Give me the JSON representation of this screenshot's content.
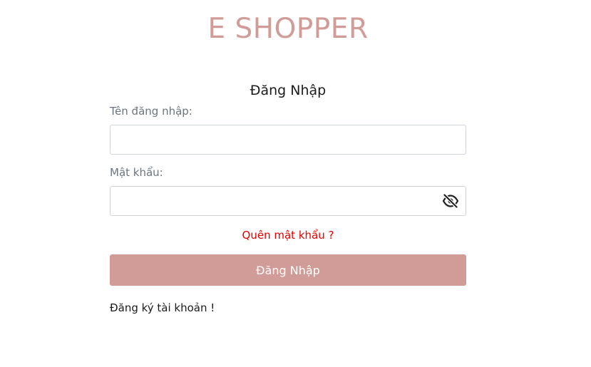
{
  "brand": {
    "title": "E SHOPPER"
  },
  "login": {
    "heading": "Đăng Nhập",
    "username_label": "Tên đăng nhập:",
    "username_value": "",
    "username_placeholder": "",
    "password_label": "Mật khẩu:",
    "password_value": "",
    "password_placeholder": "",
    "password_toggle_icon": "eye-slash-icon",
    "forgot_link": "Quên mật khẩu ?",
    "submit_label": "Đăng Nhập",
    "register_link": "Đăng ký tài khoản !"
  },
  "colors": {
    "brand": "#d19c97",
    "forgot_link": "#e60000",
    "submit_bg": "#d19c97"
  }
}
